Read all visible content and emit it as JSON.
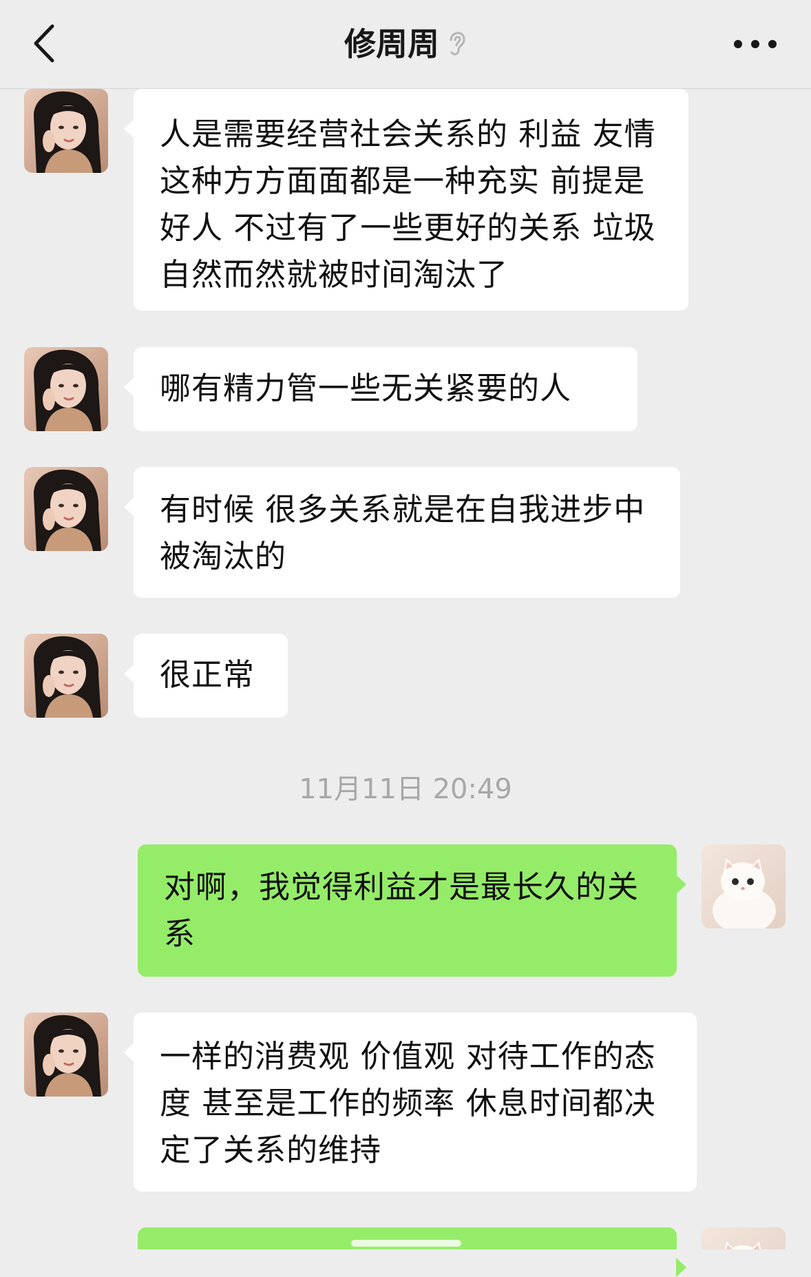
{
  "header": {
    "title": "修周周",
    "back_icon": "chevron-left-icon",
    "ear_icon": "ear-icon",
    "more_icon": "more-dots-icon"
  },
  "colors": {
    "background": "#ededed",
    "incoming_bubble": "#ffffff",
    "outgoing_bubble": "#95ec69",
    "timestamp": "#a8a8a8"
  },
  "messages": [
    {
      "sender": "contact",
      "text": "人是需要经营社会关系的 利益 友情 这种方方面面都是一种充实 前提是好人 不过有了一些更好的关系 垃圾自然而然就被时间淘汰了"
    },
    {
      "sender": "contact",
      "text": "哪有精力管一些无关紧要的人"
    },
    {
      "sender": "contact",
      "text": "有时候 很多关系就是在自我进步中被淘汰的"
    },
    {
      "sender": "contact",
      "text": "很正常"
    },
    {
      "sender": "me",
      "text": "对啊，我觉得利益才是最长久的关系"
    },
    {
      "sender": "contact",
      "text": "一样的消费观 价值观 对待工作的态度 甚至是工作的频率 休息时间都决定了关系的维持"
    }
  ],
  "timestamp": "11月11日 20:49"
}
